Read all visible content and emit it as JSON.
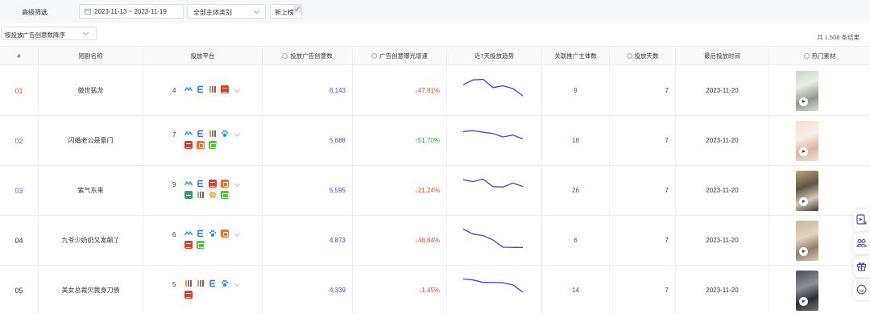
{
  "filter": {
    "label": "高级筛选",
    "date_range": "2023-11-13 ~ 2023-11-19",
    "subject_type": "全部主体类别",
    "new_label": "新上榜"
  },
  "sort": {
    "label": "按投放广告创意数降序"
  },
  "total_text": "共 1,508 条结果",
  "columns": {
    "rank": "#",
    "name": "短剧名称",
    "platform": "投放平台",
    "ad_count": "投放广告创意数",
    "growth": "广告创意曝光增速",
    "trend": "近7天投放趋势",
    "advertisers": "关联推广主体数",
    "days": "投放天数",
    "last_date": "最后投放时间",
    "material": "热门素材"
  },
  "colors": {
    "accent": "#3b4bc8",
    "down": "#f0442d",
    "up": "#27a844",
    "rank_top": "#e8543e",
    "rank_mid": "#5b6ad6"
  },
  "rows": [
    {
      "rank": "01",
      "name": "傲世猛龙",
      "platform_count": "4",
      "platform_icons": [
        "wave-icon",
        "e-icon",
        "bars-icon",
        "red-icon"
      ],
      "ad_count": "6,143",
      "growth": "47.81%",
      "growth_dir": "down",
      "trend": [
        7.0,
        9.5,
        9.8,
        5.5,
        6.4,
        5.0,
        1.2
      ],
      "advertisers": "9",
      "days": "7",
      "last_date": "2023-11-20"
    },
    {
      "rank": "02",
      "name": "闪婚老公是豪门",
      "platform_count": "7",
      "platform_icons": [
        "wave-icon",
        "e-icon",
        "bars-icon",
        "paw-icon",
        "red-icon",
        "orange-icon",
        "green-icon"
      ],
      "ad_count": "5,688",
      "growth": "51.70%",
      "growth_dir": "up",
      "trend": [
        8.6,
        9.0,
        8.3,
        7.6,
        5.8,
        6.8,
        4.8
      ],
      "advertisers": "18",
      "days": "7",
      "last_date": "2023-11-20"
    },
    {
      "rank": "03",
      "name": "紫气东来",
      "platform_count": "9",
      "platform_icons": [
        "wave-icon",
        "e-icon",
        "red-icon",
        "orange-icon",
        "teal-icon",
        "bars-icon",
        "flower-icon",
        "green-icon"
      ],
      "ad_count": "5,595",
      "growth": "21.24%",
      "growth_dir": "down",
      "trend": [
        9.5,
        8.5,
        9.8,
        5.9,
        5.7,
        7.8,
        6.0
      ],
      "advertisers": "26",
      "days": "7",
      "last_date": "2023-11-20"
    },
    {
      "rank": "04",
      "name": "九爷少奶奶又发飙了",
      "platform_count": "6",
      "platform_icons": [
        "wave-icon",
        "e-icon",
        "paw-icon",
        "orange-icon",
        "red-icon",
        "green-icon"
      ],
      "ad_count": "4,873",
      "growth": "48.84%",
      "growth_dir": "down",
      "trend": [
        9.8,
        7.2,
        6.4,
        4.2,
        0.4,
        0.3,
        0.3
      ],
      "advertisers": "6",
      "days": "7",
      "last_date": "2023-11-20"
    },
    {
      "rank": "05",
      "name": "美女总裁欠我身刀债",
      "platform_count": "5",
      "platform_icons": [
        "bars-icon",
        "bars-icon",
        "e-icon",
        "paw-icon",
        "red-icon"
      ],
      "ad_count": "4,339",
      "growth": "1.45%",
      "growth_dir": "down",
      "trend": [
        9.8,
        9.3,
        8.0,
        8.0,
        7.8,
        6.7,
        3.0
      ],
      "advertisers": "14",
      "days": "7",
      "last_date": "2023-11-20"
    }
  ],
  "side_tools": [
    "video-export-icon",
    "group-icon",
    "gift-icon",
    "chat-icon"
  ]
}
